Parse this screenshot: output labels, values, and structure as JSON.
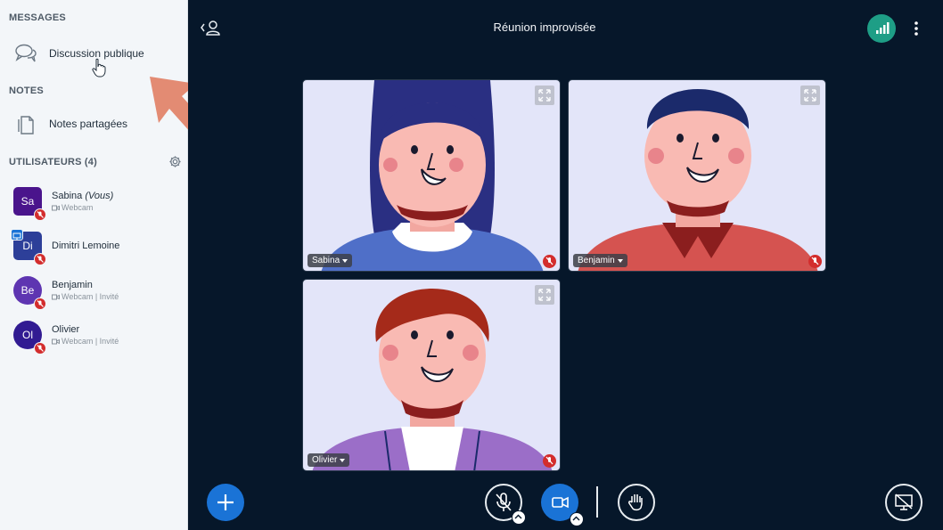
{
  "sidebar": {
    "messages_title": "MESSAGES",
    "public_chat_label": "Discussion publique",
    "notes_title": "NOTES",
    "shared_notes_label": "Notes partagées",
    "users_title": "UTILISATEURS (4)",
    "users": [
      {
        "initials": "Sa",
        "name": "Sabina",
        "you_label": "(Vous)",
        "sub": "Webcam",
        "color": "#4a148c"
      },
      {
        "initials": "Di",
        "name": "Dimitri Lemoine",
        "sub": "",
        "color": "#2d3f99"
      },
      {
        "initials": "Be",
        "name": "Benjamin",
        "sub": "Webcam | Invité",
        "color": "#5e35b1"
      },
      {
        "initials": "Ol",
        "name": "Olivier",
        "sub": "Webcam | Invité",
        "color": "#311b92"
      }
    ]
  },
  "header": {
    "title": "Réunion improvisée"
  },
  "videos": [
    {
      "name": "Sabina"
    },
    {
      "name": "Benjamin"
    },
    {
      "name": "Olivier"
    }
  ],
  "colors": {
    "accent": "#1a73d6",
    "mute": "#d32d2d",
    "signal": "#1e9e86",
    "background": "#06172a",
    "arrow": "#e38b73"
  },
  "icons": [
    "chat-icon",
    "notes-icon",
    "gear-icon",
    "back-user-icon",
    "signal-icon",
    "kebab-icon",
    "expand-icon",
    "mic-off-icon",
    "camera-icon",
    "hand-icon",
    "plus-icon",
    "screen-share-off-icon"
  ]
}
